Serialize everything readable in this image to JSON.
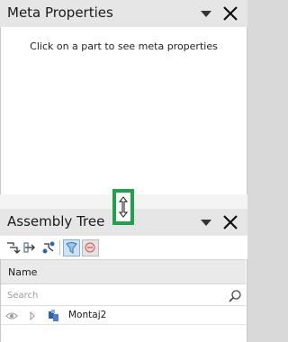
{
  "meta_panel": {
    "title": "Meta Properties",
    "hint": "Click on a part to see meta properties"
  },
  "tree_panel": {
    "title": "Assembly Tree",
    "toolbar_icons": [
      "expand-tree-icon",
      "collapse-tree-icon",
      "sync-tree-icon",
      "filter-icon",
      "tree-view-mode-icon"
    ],
    "column_header": "Name",
    "search_placeholder": "Search",
    "rows": [
      {
        "name": "Montaj2",
        "icon": "assembly-icon"
      }
    ]
  },
  "colors": {
    "header_bg": "#e6e6e6",
    "splitter_highlight": "#1fa34a",
    "panel_bg": "#ffffff"
  }
}
